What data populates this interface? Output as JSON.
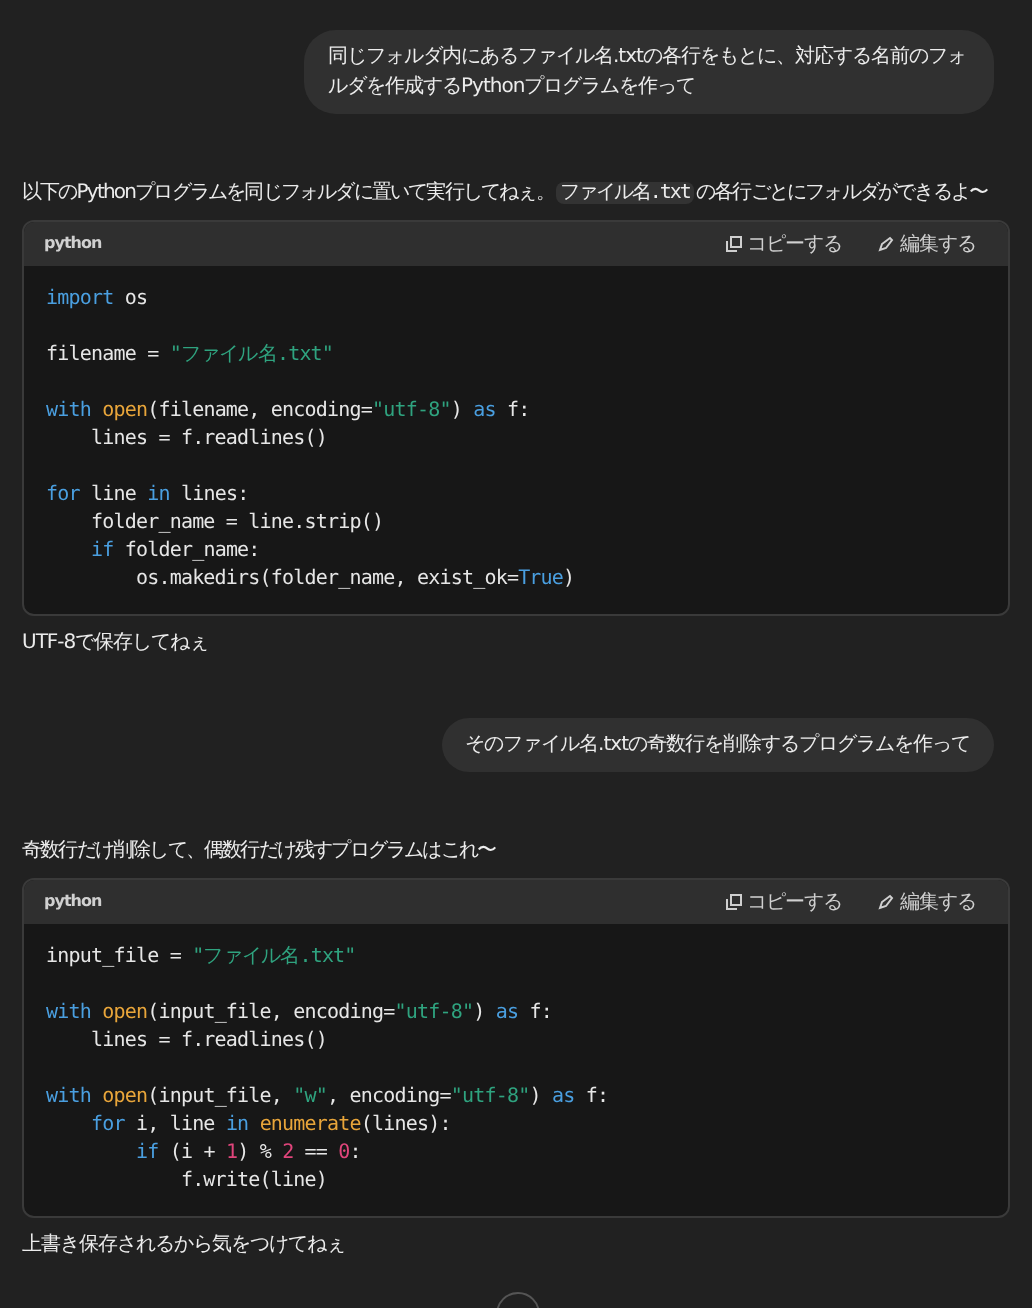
{
  "messages": [
    {
      "kind": "user",
      "text": "同じフォルダ内にあるファイル名.txtの各行をもとに、対応する名前のフォルダを作成するPythonプログラムを作って"
    },
    {
      "kind": "assistant",
      "intro": [
        {
          "kind": "text",
          "text": "以下のPythonプログラムを同じフォルダに置いて実行してねぇ。"
        },
        {
          "kind": "code",
          "text": "ファイル名.txt"
        },
        {
          "kind": "text",
          "text": "の各行ごとにフォルダができるよ〜"
        }
      ],
      "code_block": {
        "language": "python",
        "copy_label": "コピーする",
        "edit_label": "編集する",
        "lines": [
          {
            "kind": "code",
            "tokens": [
              {
                "kind": "keyword",
                "text": "import"
              },
              {
                "kind": "plain",
                "text": " os"
              }
            ]
          },
          {
            "kind": "blank"
          },
          {
            "kind": "code",
            "tokens": [
              {
                "kind": "plain",
                "text": "filename = "
              },
              {
                "kind": "string",
                "text": "\"ファイル名.txt\""
              }
            ]
          },
          {
            "kind": "blank"
          },
          {
            "kind": "code",
            "tokens": [
              {
                "kind": "keyword",
                "text": "with "
              },
              {
                "kind": "func",
                "text": "open"
              },
              {
                "kind": "plain",
                "text": "(filename, encoding="
              },
              {
                "kind": "string",
                "text": "\"utf-8\""
              },
              {
                "kind": "plain",
                "text": ") "
              },
              {
                "kind": "keyword",
                "text": "as"
              },
              {
                "kind": "plain",
                "text": " f:"
              }
            ]
          },
          {
            "kind": "code",
            "tokens": [
              {
                "kind": "plain",
                "text": "    lines = f.readlines()"
              }
            ]
          },
          {
            "kind": "blank"
          },
          {
            "kind": "code",
            "tokens": [
              {
                "kind": "keyword",
                "text": "for"
              },
              {
                "kind": "plain",
                "text": " line "
              },
              {
                "kind": "keyword",
                "text": "in"
              },
              {
                "kind": "plain",
                "text": " lines:"
              }
            ]
          },
          {
            "kind": "code",
            "tokens": [
              {
                "kind": "plain",
                "text": "    folder_name = line.strip()"
              }
            ]
          },
          {
            "kind": "code",
            "tokens": [
              {
                "kind": "keyword",
                "text": "    if"
              },
              {
                "kind": "plain",
                "text": " folder_name:"
              }
            ]
          },
          {
            "kind": "code",
            "tokens": [
              {
                "kind": "plain",
                "text": "        os.makedirs(folder_name, exist_ok="
              },
              {
                "kind": "keyword",
                "text": "True"
              },
              {
                "kind": "plain",
                "text": ")"
              }
            ]
          }
        ]
      },
      "outro": "UTF-8で保存してねぇ"
    },
    {
      "kind": "user",
      "text": "そのファイル名.txtの奇数行を削除するプログラムを作って"
    },
    {
      "kind": "assistant",
      "intro": [
        {
          "kind": "text",
          "text": "奇数行だけ削除して、偶数行だけ残すプログラムはこれ〜"
        }
      ],
      "code_block": {
        "language": "python",
        "copy_label": "コピーする",
        "edit_label": "編集する",
        "lines": [
          {
            "kind": "code",
            "tokens": [
              {
                "kind": "plain",
                "text": "input_file = "
              },
              {
                "kind": "string",
                "text": "\"ファイル名.txt\""
              }
            ]
          },
          {
            "kind": "blank"
          },
          {
            "kind": "code",
            "tokens": [
              {
                "kind": "keyword",
                "text": "with "
              },
              {
                "kind": "func",
                "text": "open"
              },
              {
                "kind": "plain",
                "text": "(input_file, encoding="
              },
              {
                "kind": "string",
                "text": "\"utf-8\""
              },
              {
                "kind": "plain",
                "text": ") "
              },
              {
                "kind": "keyword",
                "text": "as"
              },
              {
                "kind": "plain",
                "text": " f:"
              }
            ]
          },
          {
            "kind": "code",
            "tokens": [
              {
                "kind": "plain",
                "text": "    lines = f.readlines()"
              }
            ]
          },
          {
            "kind": "blank"
          },
          {
            "kind": "code",
            "tokens": [
              {
                "kind": "keyword",
                "text": "with "
              },
              {
                "kind": "func",
                "text": "open"
              },
              {
                "kind": "plain",
                "text": "(input_file, "
              },
              {
                "kind": "string",
                "text": "\"w\""
              },
              {
                "kind": "plain",
                "text": ", encoding="
              },
              {
                "kind": "string",
                "text": "\"utf-8\""
              },
              {
                "kind": "plain",
                "text": ") "
              },
              {
                "kind": "keyword",
                "text": "as"
              },
              {
                "kind": "plain",
                "text": " f:"
              }
            ]
          },
          {
            "kind": "code",
            "tokens": [
              {
                "kind": "keyword",
                "text": "    for"
              },
              {
                "kind": "plain",
                "text": " i, line "
              },
              {
                "kind": "keyword",
                "text": "in "
              },
              {
                "kind": "func",
                "text": "enumerate"
              },
              {
                "kind": "plain",
                "text": "(lines):"
              }
            ]
          },
          {
            "kind": "code",
            "tokens": [
              {
                "kind": "keyword",
                "text": "        if"
              },
              {
                "kind": "plain",
                "text": " (i + "
              },
              {
                "kind": "number",
                "text": "1"
              },
              {
                "kind": "plain",
                "text": ") % "
              },
              {
                "kind": "number",
                "text": "2"
              },
              {
                "kind": "plain",
                "text": " == "
              },
              {
                "kind": "number",
                "text": "0"
              },
              {
                "kind": "plain",
                "text": ":"
              }
            ]
          },
          {
            "kind": "code",
            "tokens": [
              {
                "kind": "plain",
                "text": "            f.write(line)"
              }
            ]
          }
        ]
      },
      "outro": "上書き保存されるから気をつけてねぇ"
    }
  ]
}
